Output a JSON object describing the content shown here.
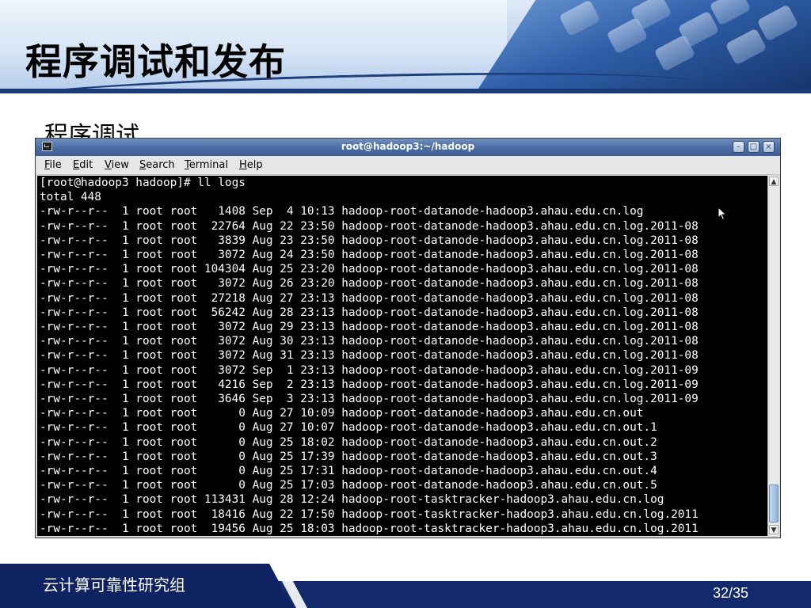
{
  "slide": {
    "title": "程序调试和发布",
    "subtitle": "程序调试",
    "footer_text": "云计算可靠性研究组",
    "page_number": "32/35"
  },
  "terminal": {
    "window_title": "root@hadoop3:~/hadoop",
    "menu": [
      {
        "u": "F",
        "rest": "ile"
      },
      {
        "u": "E",
        "rest": "dit"
      },
      {
        "u": "V",
        "rest": "iew"
      },
      {
        "u": "S",
        "rest": "earch"
      },
      {
        "u": "T",
        "rest": "erminal"
      },
      {
        "u": "H",
        "rest": "elp"
      }
    ],
    "lines": [
      "[root@hadoop3 hadoop]# ll logs",
      "total 448",
      "-rw-r--r--  1 root root   1408 Sep  4 10:13 hadoop-root-datanode-hadoop3.ahau.edu.cn.log",
      "-rw-r--r--  1 root root  22764 Aug 22 23:50 hadoop-root-datanode-hadoop3.ahau.edu.cn.log.2011-08",
      "-rw-r--r--  1 root root   3839 Aug 23 23:50 hadoop-root-datanode-hadoop3.ahau.edu.cn.log.2011-08",
      "-rw-r--r--  1 root root   3072 Aug 24 23:50 hadoop-root-datanode-hadoop3.ahau.edu.cn.log.2011-08",
      "-rw-r--r--  1 root root 104304 Aug 25 23:20 hadoop-root-datanode-hadoop3.ahau.edu.cn.log.2011-08",
      "-rw-r--r--  1 root root   3072 Aug 26 23:20 hadoop-root-datanode-hadoop3.ahau.edu.cn.log.2011-08",
      "-rw-r--r--  1 root root  27218 Aug 27 23:13 hadoop-root-datanode-hadoop3.ahau.edu.cn.log.2011-08",
      "-rw-r--r--  1 root root  56242 Aug 28 23:13 hadoop-root-datanode-hadoop3.ahau.edu.cn.log.2011-08",
      "-rw-r--r--  1 root root   3072 Aug 29 23:13 hadoop-root-datanode-hadoop3.ahau.edu.cn.log.2011-08",
      "-rw-r--r--  1 root root   3072 Aug 30 23:13 hadoop-root-datanode-hadoop3.ahau.edu.cn.log.2011-08",
      "-rw-r--r--  1 root root   3072 Aug 31 23:13 hadoop-root-datanode-hadoop3.ahau.edu.cn.log.2011-08",
      "-rw-r--r--  1 root root   3072 Sep  1 23:13 hadoop-root-datanode-hadoop3.ahau.edu.cn.log.2011-09",
      "-rw-r--r--  1 root root   4216 Sep  2 23:13 hadoop-root-datanode-hadoop3.ahau.edu.cn.log.2011-09",
      "-rw-r--r--  1 root root   3646 Sep  3 23:13 hadoop-root-datanode-hadoop3.ahau.edu.cn.log.2011-09",
      "-rw-r--r--  1 root root      0 Aug 27 10:09 hadoop-root-datanode-hadoop3.ahau.edu.cn.out",
      "-rw-r--r--  1 root root      0 Aug 27 10:07 hadoop-root-datanode-hadoop3.ahau.edu.cn.out.1",
      "-rw-r--r--  1 root root      0 Aug 25 18:02 hadoop-root-datanode-hadoop3.ahau.edu.cn.out.2",
      "-rw-r--r--  1 root root      0 Aug 25 17:39 hadoop-root-datanode-hadoop3.ahau.edu.cn.out.3",
      "-rw-r--r--  1 root root      0 Aug 25 17:31 hadoop-root-datanode-hadoop3.ahau.edu.cn.out.4",
      "-rw-r--r--  1 root root      0 Aug 25 17:03 hadoop-root-datanode-hadoop3.ahau.edu.cn.out.5",
      "-rw-r--r--  1 root root 113431 Aug 28 12:24 hadoop-root-tasktracker-hadoop3.ahau.edu.cn.log",
      "-rw-r--r--  1 root root  18416 Aug 22 17:50 hadoop-root-tasktracker-hadoop3.ahau.edu.cn.log.2011",
      "-rw-r--r--  1 root root  19456 Aug 25 18:03 hadoop-root-tasktracker-hadoop3.ahau.edu.cn.log.2011"
    ]
  },
  "colors": {
    "terminal_bg": "#000000",
    "terminal_fg": "#ffffff",
    "titlebar": "#4d6fa6",
    "footer": "#12296a",
    "header_rule": "#1b3a78"
  }
}
